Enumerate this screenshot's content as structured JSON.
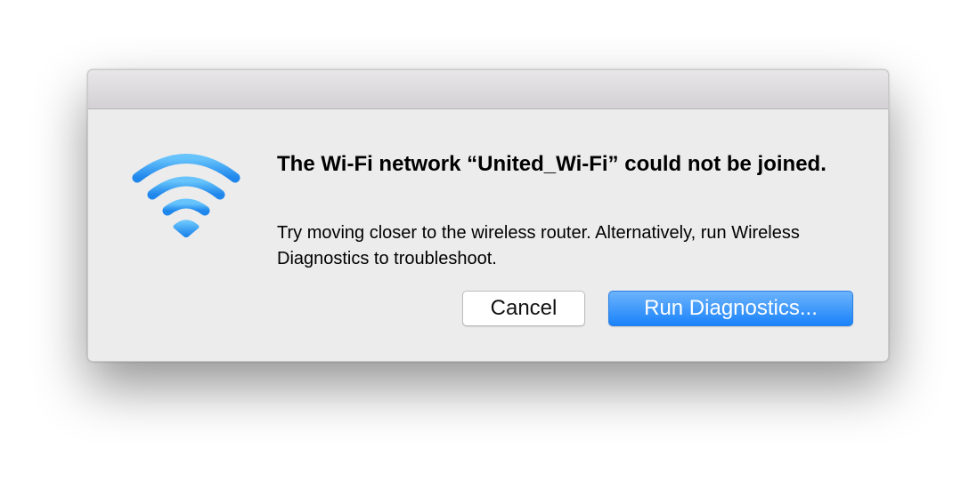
{
  "dialog": {
    "icon": "wifi-icon",
    "heading": "The Wi-Fi network “United_Wi-Fi” could not be joined.",
    "message": "Try moving closer to the wireless router. Alternatively, run Wireless Diagnostics to troubleshoot.",
    "cancel_label": "Cancel",
    "primary_label": "Run Diagnostics..."
  },
  "colors": {
    "accent": "#1a83fb",
    "wifi_icon": "#3a9ff0",
    "dialog_background": "#ececec"
  }
}
